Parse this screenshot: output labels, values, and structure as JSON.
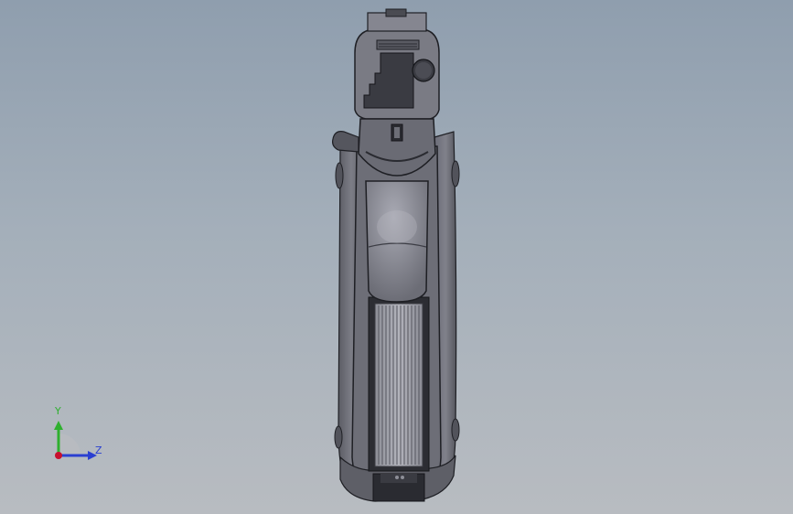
{
  "viewport": {
    "background_top": "#8f9eae",
    "background_bottom": "#b8bcc1"
  },
  "model": {
    "body_color": "#74757e",
    "dark_color": "#2a2b31",
    "light_color": "#b4b5be"
  },
  "triad": {
    "y_label": "Y",
    "z_label": "Z",
    "y_color": "#2fb02f",
    "z_color": "#2a3fd1",
    "origin_color": "#c8102e",
    "origin_icon": "triad-origin-icon"
  }
}
